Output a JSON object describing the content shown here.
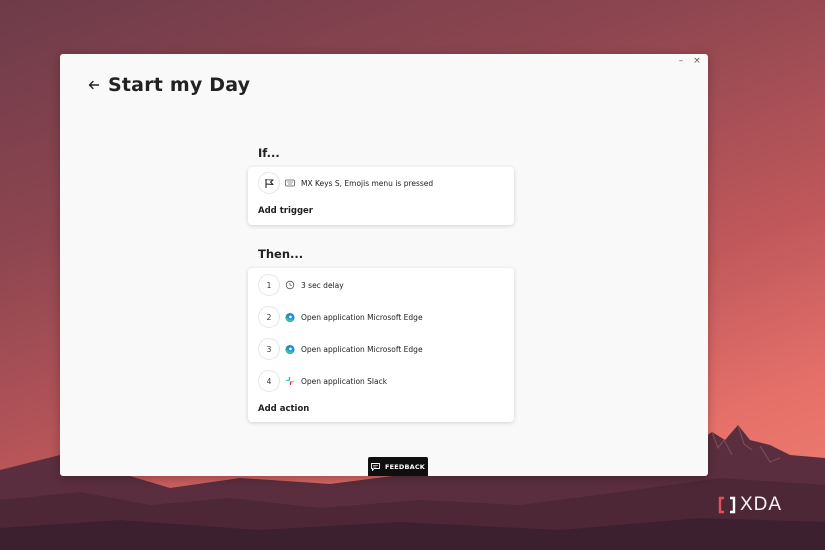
{
  "window": {
    "minimize_glyph": "–",
    "close_glyph": "×",
    "title": "Start my Day"
  },
  "if_section": {
    "label": "If...",
    "trigger": {
      "icon": "flag-icon",
      "sub_icon": "keyboard-icon",
      "text": "MX Keys S, Emojis menu is pressed"
    },
    "add_label": "Add trigger"
  },
  "then_section": {
    "label": "Then...",
    "actions": [
      {
        "number": "1",
        "icon": "clock-icon",
        "text": "3 sec delay"
      },
      {
        "number": "2",
        "icon": "microsoft-edge-icon",
        "text": "Open application Microsoft Edge"
      },
      {
        "number": "3",
        "icon": "microsoft-edge-icon",
        "text": "Open application Microsoft Edge"
      },
      {
        "number": "4",
        "icon": "slack-icon",
        "text": "Open application Slack"
      }
    ],
    "add_label": "Add action"
  },
  "feedback": {
    "icon": "feedback-chat-icon",
    "label": "FEEDBACK"
  },
  "watermark": {
    "text": "XDA"
  },
  "colors": {
    "accent_edge_blue": "#1a8fd8",
    "accent_edge_green": "#3cc48b",
    "feedback_bg": "#0f0f0f",
    "window_bg": "#f9f9f9"
  }
}
